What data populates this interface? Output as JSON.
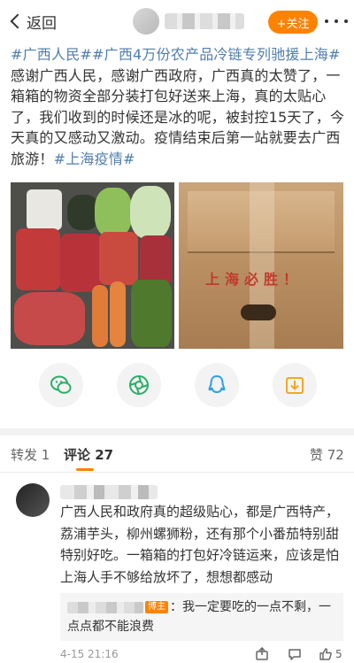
{
  "nav": {
    "back_label": "返回",
    "follow_label": "+关注"
  },
  "post": {
    "tag1": "#广西人民#",
    "tag2": "#广西4万份农产品冷链专列驰援上海#",
    "body": "感谢广西人民，感谢广西政府，广西真的太赞了，一箱箱的物资全部分装打包好送来上海，真的太贴心了，我们收到的时候还是冰的呢，被封控15天了，今天真的又感动又激动。疫情结束后第一站就要去广西旅游！",
    "tag3": "#上海疫情#",
    "box_stamp": "上海必胜！"
  },
  "share": [
    {
      "icon": "wechat-icon"
    },
    {
      "icon": "moments-icon"
    },
    {
      "icon": "qq-icon"
    },
    {
      "icon": "save-image-icon"
    }
  ],
  "tabs": {
    "repost": "转发 1",
    "comment": "评论 27",
    "like": "赞 72"
  },
  "comment": {
    "text": "广西人民和政府真的超级贴心，都是广西特产，荔浦芋头，柳州螺狮粉，还有那个小番茄特别甜特别好吃。一箱箱的打包好冷链运来，应该是怕上海人手不够给放坏了，想想都感动",
    "reply_badge": "博主",
    "reply_text": "：我一定要吃的一点不剩，一点点都不能浪费",
    "time": "4-15 21:16",
    "like_count": "5"
  },
  "colors": {
    "accent": "#ff8200",
    "link": "#507daf"
  }
}
